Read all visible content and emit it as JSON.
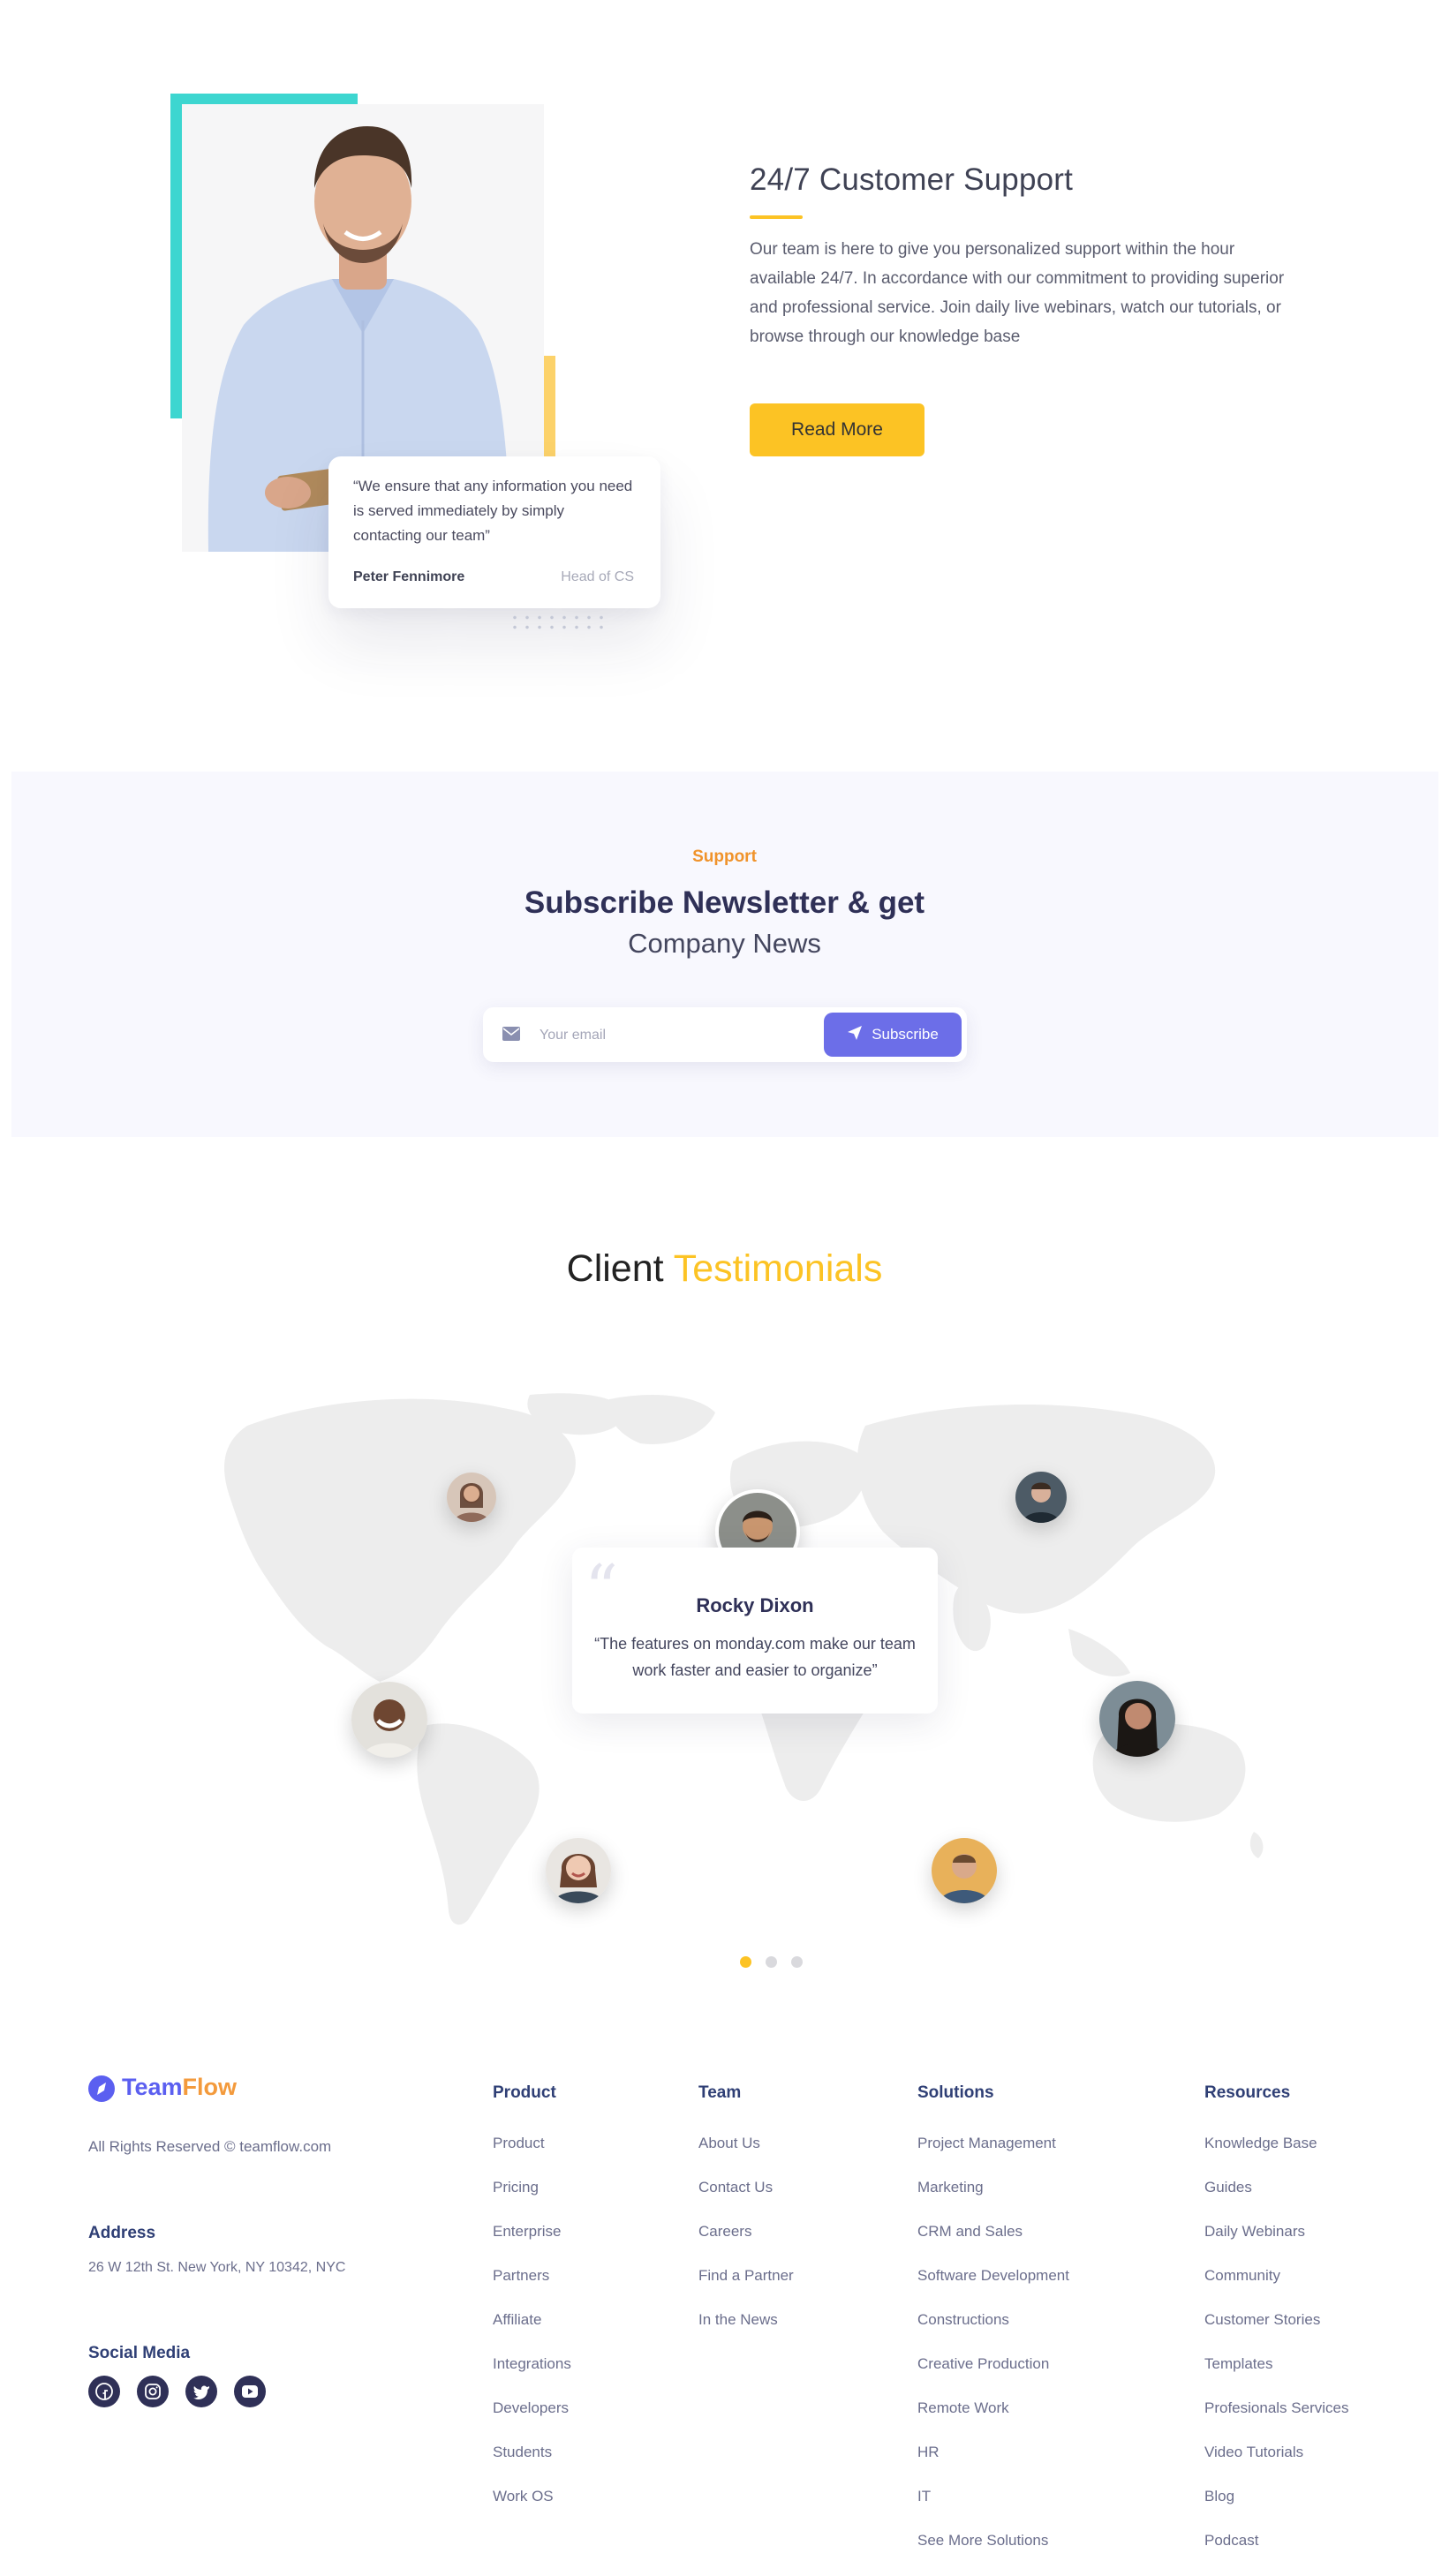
{
  "support": {
    "title": "24/7 Customer Support",
    "description": "Our team is here to give you personalized support within the hour available 24/7. In accordance with our commitment to providing superior and professional service. Join daily live webinars, watch our tutorials, or browse through our knowledge base",
    "read_more": "Read More",
    "quote": "“We ensure that any information you need is served immediately by simply contacting our team”",
    "quote_author": "Peter Fennimore",
    "quote_role": "Head of CS"
  },
  "newsletter": {
    "label": "Support",
    "title": "Subscribe Newsletter & get",
    "subtitle": "Company News",
    "email_placeholder": "Your email",
    "button": "Subscribe"
  },
  "testimonials": {
    "title_plain": "Client",
    "title_accent": "Testimonials",
    "active_name": "Rocky Dixon",
    "active_quote": "“The features on monday.com make our team work faster and easier to organize”",
    "slides_total": 3,
    "active_slide": 1
  },
  "footer": {
    "brand_part1": "Team",
    "brand_part2": "Flow",
    "copyright": "All Rights Reserved © teamflow.com",
    "address_heading": "Address",
    "address": "26 W 12th St. New York, NY 10342, NYC",
    "social_heading": "Social Media",
    "social": [
      "facebook-icon",
      "instagram-icon",
      "twitter-icon",
      "youtube-icon"
    ],
    "columns": [
      {
        "heading": "Product",
        "links": [
          "Product",
          "Pricing",
          "Enterprise",
          "Partners",
          "Affiliate",
          "Integrations",
          "Developers",
          "Students",
          "Work OS"
        ]
      },
      {
        "heading": "Team",
        "links": [
          "About Us",
          "Contact Us",
          "Careers",
          "Find a Partner",
          "In the News"
        ]
      },
      {
        "heading": "Solutions",
        "links": [
          "Project Management",
          "Marketing",
          "CRM and Sales",
          "Software Development",
          "Constructions",
          "Creative Production",
          "Remote Work",
          "HR",
          "IT",
          "See More Solutions"
        ]
      },
      {
        "heading": "Resources",
        "links": [
          "Knowledge Base",
          "Guides",
          "Daily Webinars",
          "Community",
          "Customer Stories",
          "Templates",
          "Profesionals Services",
          "Video Tutorials",
          "Blog",
          "Podcast"
        ]
      }
    ]
  },
  "colors": {
    "accent_yellow": "#fcc324",
    "teal": "#3dd6d0",
    "primary_purple": "#6c6ee8",
    "navy": "#2f3057",
    "orange": "#f0932b"
  }
}
